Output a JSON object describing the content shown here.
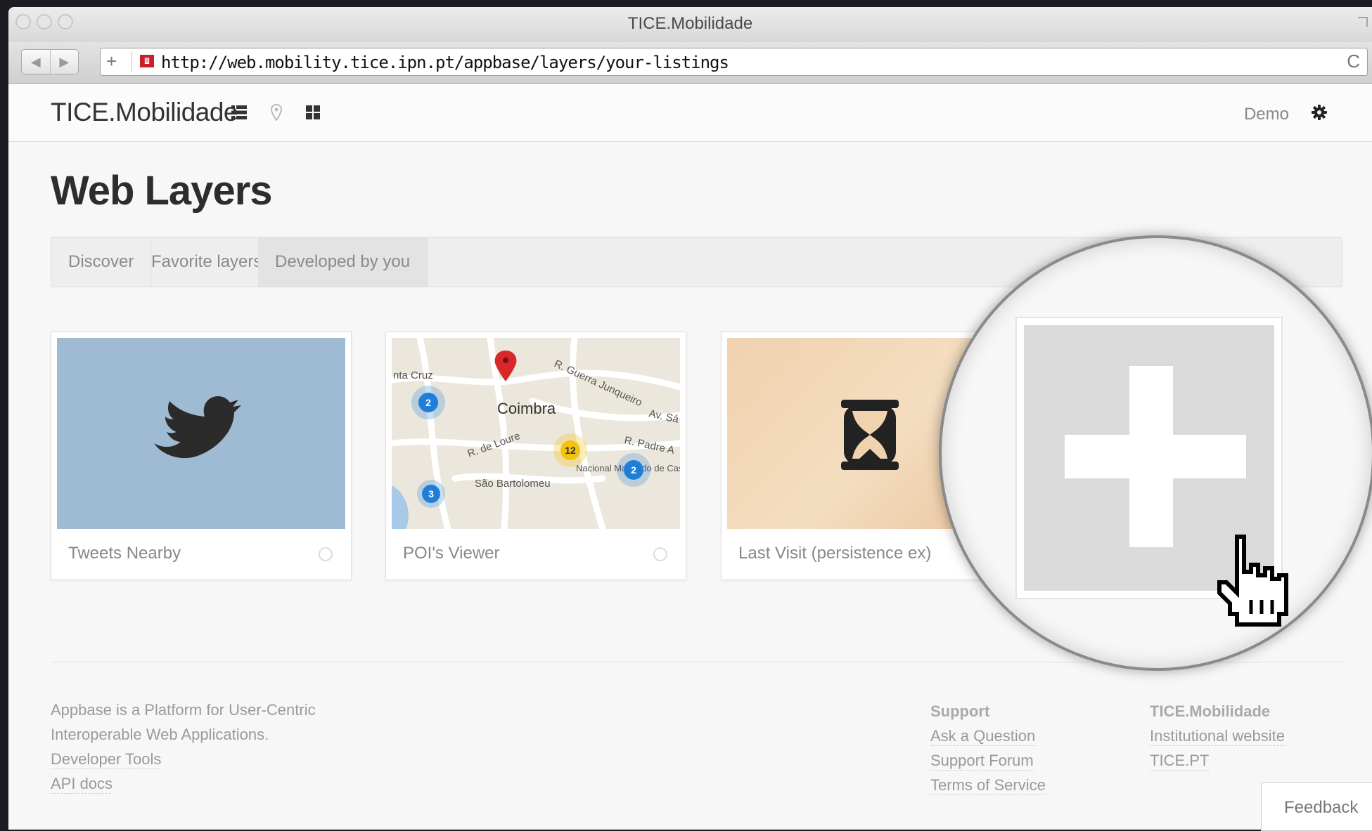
{
  "window": {
    "title": "TICE.Mobilidade"
  },
  "browser": {
    "url": "http://web.mobility.tice.ipn.pt/appbase/layers/your-listings",
    "back_icon": "◀",
    "forward_icon": "▶",
    "add_tab_icon": "+",
    "reload_icon": "C"
  },
  "header": {
    "brand": "TICE.Mobilidade",
    "user": "Demo",
    "icons": [
      "list-icon",
      "map-marker-icon",
      "grid-icon",
      "gear-icon"
    ]
  },
  "page": {
    "title": "Web Layers"
  },
  "tabs": [
    {
      "label": "Discover",
      "active": false
    },
    {
      "label": "Favorite layers",
      "active": false
    },
    {
      "label": "Developed by you",
      "active": true
    }
  ],
  "cards": [
    {
      "label": "Tweets Nearby",
      "thumb": "twitter-bird"
    },
    {
      "label": "POI's Viewer",
      "thumb": "map"
    },
    {
      "label": "Last Visit (persistence ex)",
      "thumb": "hourglass"
    }
  ],
  "map_thumb": {
    "city": "Coimbra",
    "district": "São Bartolomeu",
    "streets": [
      "R. Guerra Junqueiro",
      "R. de Loure",
      "R. Padre A",
      "Av. Sá"
    ],
    "places": [
      "nta Cruz",
      "Nacional Machado de Castro"
    ],
    "clusters": [
      "2",
      "12",
      "2",
      "3"
    ]
  },
  "footer": {
    "about_line1": "Appbase is a Platform for User-Centric",
    "about_line2": "Interoperable Web Applications.",
    "dev_tools": "Developer Tools",
    "api_docs": "API docs",
    "support_heading": "Support",
    "ask_question": "Ask a Question",
    "support_forum": "Support Forum",
    "terms": "Terms of Service",
    "brand_heading": "TICE.Mobilidade",
    "institutional": "Institutional website",
    "tice_pt": "TICE.PT"
  },
  "feedback": "Feedback",
  "colors": {
    "twitter_bg": "#9fbbd3",
    "add_tile": "#dadada",
    "cluster_blue": "#1f7fd8",
    "cluster_yellow": "#f2c20e"
  }
}
